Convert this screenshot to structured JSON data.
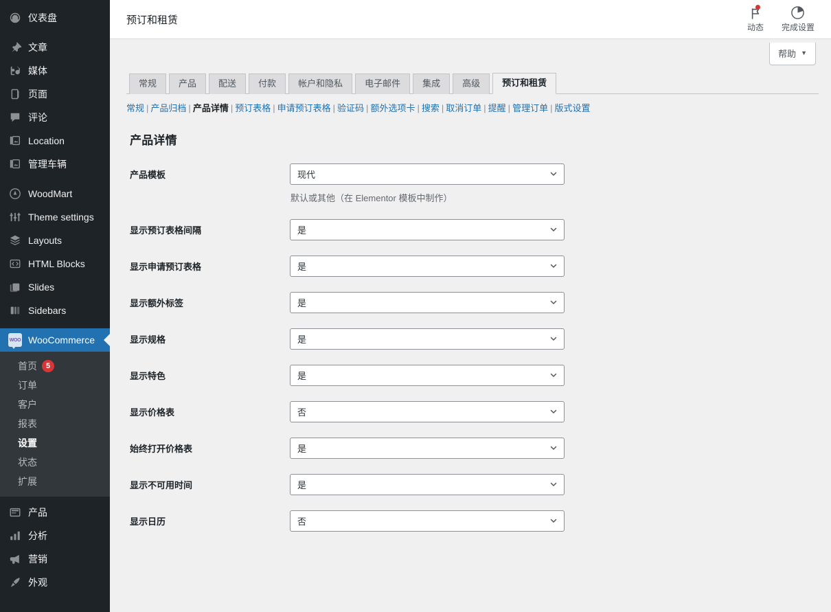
{
  "sidebar": {
    "items": [
      {
        "label": "仪表盘",
        "icon": "dashboard-icon"
      },
      {
        "label": "文章",
        "icon": "pin-icon"
      },
      {
        "label": "媒体",
        "icon": "media-icon"
      },
      {
        "label": "页面",
        "icon": "page-icon"
      },
      {
        "label": "评论",
        "icon": "comment-icon"
      },
      {
        "label": "Location",
        "icon": "custom-post-icon"
      },
      {
        "label": "管理车辆",
        "icon": "custom-post-icon"
      },
      {
        "label": "WoodMart",
        "icon": "woodmart-icon"
      },
      {
        "label": "Theme settings",
        "icon": "sliders-icon"
      },
      {
        "label": "Layouts",
        "icon": "layers-icon"
      },
      {
        "label": "HTML Blocks",
        "icon": "code-icon"
      },
      {
        "label": "Slides",
        "icon": "slides-icon"
      },
      {
        "label": "Sidebars",
        "icon": "sidebars-icon"
      }
    ],
    "current_item": {
      "label": "WooCommerce",
      "icon": "woo-icon"
    },
    "submenu": [
      {
        "label": "首页",
        "badge": "5"
      },
      {
        "label": "订单"
      },
      {
        "label": "客户"
      },
      {
        "label": "报表"
      },
      {
        "label": "设置",
        "current": true
      },
      {
        "label": "状态"
      },
      {
        "label": "扩展"
      }
    ],
    "items_after": [
      {
        "label": "产品",
        "icon": "products-icon"
      },
      {
        "label": "分析",
        "icon": "analytics-icon"
      },
      {
        "label": "营销",
        "icon": "marketing-icon"
      },
      {
        "label": "外观",
        "icon": "appearance-icon"
      }
    ]
  },
  "header": {
    "title": "预订和租赁",
    "actions": [
      {
        "label": "动态",
        "icon": "flag-icon",
        "has_notification": true
      },
      {
        "label": "完成设置",
        "icon": "progress-circle-icon",
        "has_notification": false
      }
    ]
  },
  "help": {
    "label": "帮助",
    "caret": "▼"
  },
  "tabs": [
    {
      "label": "常规",
      "active": false
    },
    {
      "label": "产品",
      "active": false
    },
    {
      "label": "配送",
      "active": false
    },
    {
      "label": "付款",
      "active": false
    },
    {
      "label": "帐户和隐私",
      "active": false
    },
    {
      "label": "电子邮件",
      "active": false
    },
    {
      "label": "集成",
      "active": false
    },
    {
      "label": "高级",
      "active": false
    },
    {
      "label": "预订和租赁",
      "active": true
    }
  ],
  "subnav": [
    {
      "label": "常规",
      "current": false
    },
    {
      "label": "产品归档",
      "current": false
    },
    {
      "label": "产品详情",
      "current": true
    },
    {
      "label": "预订表格",
      "current": false
    },
    {
      "label": "申请预订表格",
      "current": false
    },
    {
      "label": "验证码",
      "current": false
    },
    {
      "label": "额外选项卡",
      "current": false
    },
    {
      "label": "搜索",
      "current": false
    },
    {
      "label": "取消订单",
      "current": false
    },
    {
      "label": "提醒",
      "current": false
    },
    {
      "label": "管理订单",
      "current": false
    },
    {
      "label": "版式设置",
      "current": false
    }
  ],
  "section": {
    "title": "产品详情"
  },
  "fields": [
    {
      "label": "产品模板",
      "value": "现代",
      "description": "默认或其他（在 Elementor 模板中制作）"
    },
    {
      "label": "显示预订表格间隔",
      "value": "是",
      "description": ""
    },
    {
      "label": "显示申请预订表格",
      "value": "是",
      "description": ""
    },
    {
      "label": "显示额外标签",
      "value": "是",
      "description": ""
    },
    {
      "label": "显示规格",
      "value": "是",
      "description": ""
    },
    {
      "label": "显示特色",
      "value": "是",
      "description": ""
    },
    {
      "label": "显示价格表",
      "value": "否",
      "description": ""
    },
    {
      "label": "始终打开价格表",
      "value": "是",
      "description": ""
    },
    {
      "label": "显示不可用时间",
      "value": "是",
      "description": ""
    },
    {
      "label": "显示日历",
      "value": "否",
      "description": ""
    }
  ],
  "colors": {
    "sidebar_bg": "#1d2327",
    "submenu_bg": "#32373c",
    "accent": "#2271b1",
    "badge": "#d63638",
    "content_bg": "#f0f0f1",
    "link": "#2271b1"
  }
}
